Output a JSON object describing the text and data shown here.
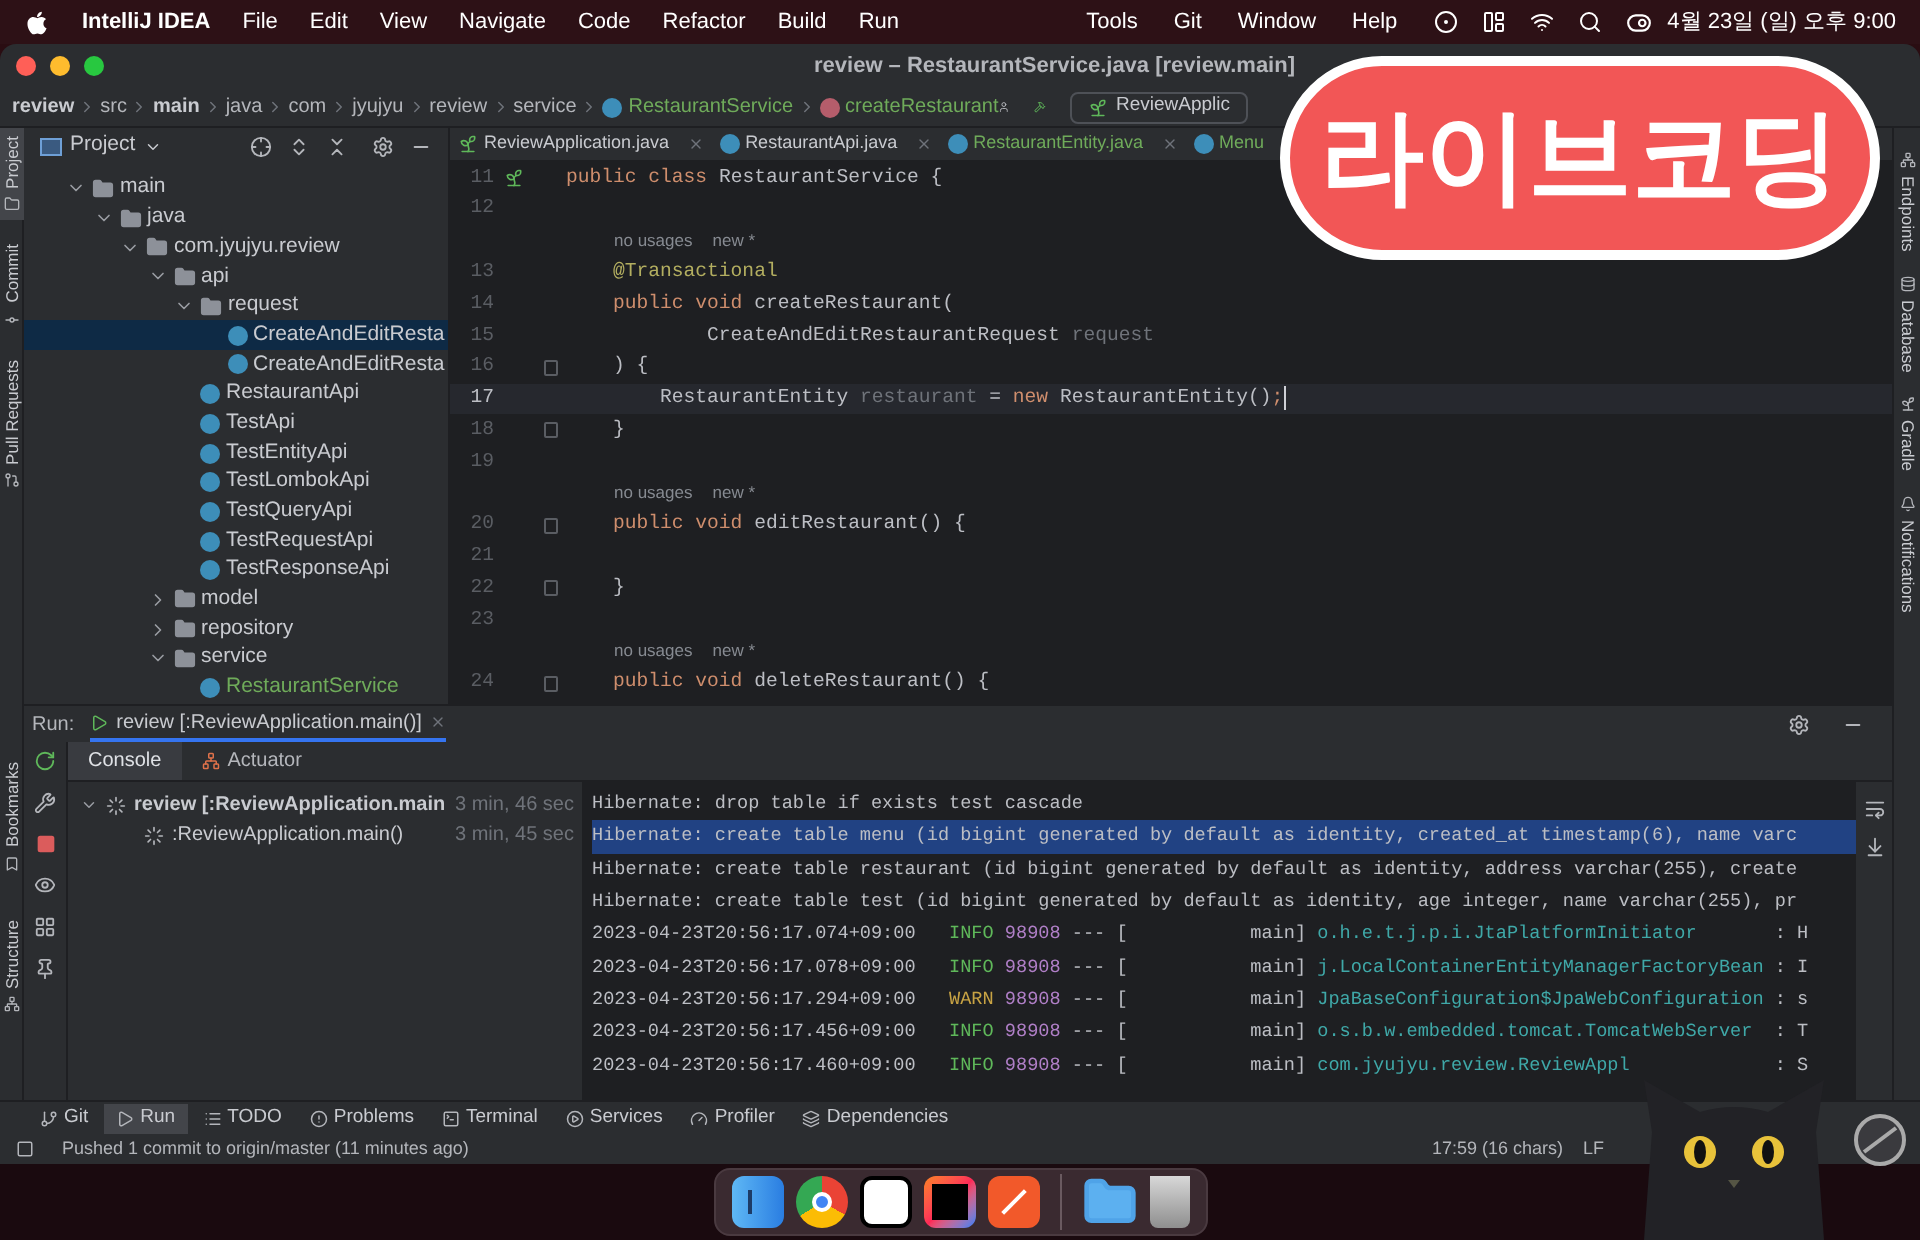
{
  "menu_bar": {
    "app_name": "IntelliJ IDEA",
    "left_items": [
      "File",
      "Edit",
      "View",
      "Navigate",
      "Code",
      "Refactor",
      "Build",
      "Run"
    ],
    "right_items": [
      "Tools",
      "Git",
      "Window",
      "Help"
    ],
    "clock": "4월 23일 (일) 오후 9:00"
  },
  "window": {
    "title": "review – RestaurantService.java [review.main]"
  },
  "breadcrumb": [
    {
      "label": "review",
      "kind": "folder",
      "emphasized": true
    },
    {
      "label": "src",
      "kind": "folder",
      "emphasized": false
    },
    {
      "label": "main",
      "kind": "folder",
      "emphasized": true
    },
    {
      "label": "java",
      "kind": "folder",
      "emphasized": false
    },
    {
      "label": "com",
      "kind": "folder",
      "emphasized": false
    },
    {
      "label": "jyujyu",
      "kind": "folder",
      "emphasized": false
    },
    {
      "label": "review",
      "kind": "folder",
      "emphasized": false
    },
    {
      "label": "service",
      "kind": "folder",
      "emphasized": false
    },
    {
      "label": "RestaurantService",
      "kind": "class",
      "emphasized": false
    },
    {
      "label": "createRestaurant",
      "kind": "method",
      "emphasized": false
    }
  ],
  "run_config": {
    "label": "ReviewApplic"
  },
  "left_tool_strip": {
    "top": [
      {
        "label": "Project",
        "selected": true
      },
      {
        "label": "Commit",
        "selected": false
      },
      {
        "label": "Pull Requests",
        "selected": false
      }
    ],
    "bottom": [
      {
        "label": "Bookmarks",
        "selected": false
      },
      {
        "label": "Structure",
        "selected": false
      }
    ]
  },
  "right_tool_strip": [
    {
      "label": "Endpoints"
    },
    {
      "label": "Database"
    },
    {
      "label": "Gradle"
    },
    {
      "label": "Notifications"
    }
  ],
  "project_panel": {
    "title": "Project",
    "tree": [
      {
        "label": "main",
        "kind": "folder",
        "expanded": true,
        "selected": false,
        "added": false,
        "children": [
          {
            "label": "java",
            "kind": "folder",
            "expanded": true,
            "selected": false,
            "added": false,
            "children": [
              {
                "label": "com.jyujyu.review",
                "kind": "folder",
                "expanded": true,
                "selected": false,
                "added": false,
                "children": [
                  {
                    "label": "api",
                    "kind": "folder",
                    "expanded": true,
                    "selected": false,
                    "added": false,
                    "children": [
                      {
                        "label": "request",
                        "kind": "folder",
                        "expanded": true,
                        "selected": false,
                        "added": false,
                        "children": [
                          {
                            "label": "CreateAndEditResta",
                            "kind": "class",
                            "selected": true,
                            "added": false
                          },
                          {
                            "label": "CreateAndEditResta",
                            "kind": "class",
                            "selected": false,
                            "added": false
                          }
                        ]
                      },
                      {
                        "label": "RestaurantApi",
                        "kind": "class",
                        "selected": false,
                        "added": false
                      },
                      {
                        "label": "TestApi",
                        "kind": "class",
                        "selected": false,
                        "added": false
                      },
                      {
                        "label": "TestEntityApi",
                        "kind": "class",
                        "selected": false,
                        "added": false
                      },
                      {
                        "label": "TestLombokApi",
                        "kind": "class",
                        "selected": false,
                        "added": false
                      },
                      {
                        "label": "TestQueryApi",
                        "kind": "class",
                        "selected": false,
                        "added": false
                      },
                      {
                        "label": "TestRequestApi",
                        "kind": "class",
                        "selected": false,
                        "added": false
                      },
                      {
                        "label": "TestResponseApi",
                        "kind": "class",
                        "selected": false,
                        "added": false
                      }
                    ]
                  },
                  {
                    "label": "model",
                    "kind": "folder",
                    "expanded": false,
                    "selected": false,
                    "added": false
                  },
                  {
                    "label": "repository",
                    "kind": "folder",
                    "expanded": false,
                    "selected": false,
                    "added": false
                  },
                  {
                    "label": "service",
                    "kind": "folder",
                    "expanded": true,
                    "selected": false,
                    "added": false,
                    "children": [
                      {
                        "label": "RestaurantService",
                        "kind": "class",
                        "selected": false,
                        "added": true
                      }
                    ]
                  }
                ]
              }
            ]
          }
        ]
      }
    ]
  },
  "editor_tabs": [
    {
      "label": "ReviewApplication.java",
      "kind": "app",
      "added": false
    },
    {
      "label": "RestaurantApi.java",
      "kind": "class",
      "added": false
    },
    {
      "label": "RestaurantEntity.java",
      "kind": "class",
      "added": true
    },
    {
      "label": "Menu",
      "kind": "class",
      "added": true
    }
  ],
  "editor": {
    "lines": [
      {
        "kind": "code",
        "number": "11",
        "marker": true,
        "fold": false,
        "current": false,
        "tokens": [
          {
            "text": "public class ",
            "kind": "keyword"
          },
          {
            "text": "RestaurantService {",
            "kind": "plain"
          }
        ]
      },
      {
        "kind": "code",
        "number": "12",
        "marker": false,
        "fold": false,
        "current": false
      },
      {
        "kind": "hint",
        "texts": [
          "no usages",
          "new *"
        ]
      },
      {
        "kind": "code",
        "number": "13",
        "marker": false,
        "fold": false,
        "current": false,
        "tokens": [
          {
            "text": "    @Transactional",
            "kind": "annotation"
          }
        ]
      },
      {
        "kind": "code",
        "number": "14",
        "marker": false,
        "fold": false,
        "current": false,
        "tokens": [
          {
            "text": "    public void ",
            "kind": "keyword"
          },
          {
            "text": "createRestaurant(",
            "kind": "plain"
          }
        ]
      },
      {
        "kind": "code",
        "number": "15",
        "marker": false,
        "fold": false,
        "current": false,
        "tokens": [
          {
            "text": "            CreateAndEditRestaurantRequest ",
            "kind": "plain"
          },
          {
            "text": "request",
            "kind": "unused"
          }
        ]
      },
      {
        "kind": "code",
        "number": "16",
        "marker": false,
        "fold": true,
        "current": false,
        "tokens": [
          {
            "text": "    ) {",
            "kind": "plain"
          }
        ]
      },
      {
        "kind": "code",
        "number": "17",
        "marker": false,
        "fold": false,
        "current": true,
        "tokens": [
          {
            "text": "        RestaurantEntity ",
            "kind": "plain"
          },
          {
            "text": "restaurant",
            "kind": "unused"
          },
          {
            "text": " = ",
            "kind": "plain"
          },
          {
            "text": "new ",
            "kind": "keyword"
          },
          {
            "text": "RestaurantEntity()",
            "kind": "plain"
          },
          {
            "text": ";",
            "kind": "keyword"
          }
        ]
      },
      {
        "kind": "code",
        "number": "18",
        "marker": false,
        "fold": true,
        "current": false,
        "tokens": [
          {
            "text": "    }",
            "kind": "plain"
          }
        ]
      },
      {
        "kind": "code",
        "number": "19",
        "marker": false,
        "fold": false,
        "current": false
      },
      {
        "kind": "hint",
        "texts": [
          "no usages",
          "new *"
        ]
      },
      {
        "kind": "code",
        "number": "20",
        "marker": false,
        "fold": true,
        "current": false,
        "tokens": [
          {
            "text": "    public void ",
            "kind": "keyword"
          },
          {
            "text": "editRestaurant() {",
            "kind": "plain"
          }
        ]
      },
      {
        "kind": "code",
        "number": "21",
        "marker": false,
        "fold": false,
        "current": false
      },
      {
        "kind": "code",
        "number": "22",
        "marker": false,
        "fold": true,
        "current": false,
        "tokens": [
          {
            "text": "    }",
            "kind": "plain"
          }
        ]
      },
      {
        "kind": "code",
        "number": "23",
        "marker": false,
        "fold": false,
        "current": false
      },
      {
        "kind": "hint",
        "texts": [
          "no usages",
          "new *"
        ]
      },
      {
        "kind": "code",
        "number": "24",
        "marker": false,
        "fold": true,
        "current": false,
        "tokens": [
          {
            "text": "    public void ",
            "kind": "keyword"
          },
          {
            "text": "deleteRestaurant() {",
            "kind": "plain"
          }
        ]
      }
    ]
  },
  "run_panel": {
    "label": "Run:",
    "tab": "review [:ReviewApplication.main()]",
    "subtabs": [
      {
        "label": "Console",
        "selected": true
      },
      {
        "label": "Actuator",
        "selected": false
      }
    ],
    "tree": [
      {
        "label": "review [:ReviewApplication.main",
        "time": "3 min, 46 sec",
        "expanded": true,
        "children": [
          {
            "label": ":ReviewApplication.main()",
            "time": "3 min, 45 sec"
          }
        ]
      }
    ],
    "console": [
      {
        "kind": "text",
        "text": "Hibernate: drop table if exists test cascade",
        "selected": false
      },
      {
        "kind": "text",
        "text": "Hibernate: create table menu (id bigint generated by default as identity, created_at timestamp(6), name varc",
        "selected": true
      },
      {
        "kind": "text",
        "text": "Hibernate: create table restaurant (id bigint generated by default as identity, address varchar(255), create",
        "selected": false
      },
      {
        "kind": "text",
        "text": "Hibernate: create table test (id bigint generated by default as identity, age integer, name varchar(255), pr",
        "selected": false
      },
      {
        "kind": "info_log",
        "time": "2023-04-23T20:56:17.074+09:00",
        "severity_text": "INFO",
        "pid": "98908",
        "sep": "---",
        "thread": "[           main]",
        "logger": "o.h.e.t.j.p.i.JtaPlatformInitiator",
        "tail": ": H",
        "selected": false
      },
      {
        "kind": "info_log",
        "time": "2023-04-23T20:56:17.078+09:00",
        "severity_text": "INFO",
        "pid": "98908",
        "sep": "---",
        "thread": "[           main]",
        "logger": "j.LocalContainerEntityManagerFactoryBean",
        "tail": ": I",
        "selected": false
      },
      {
        "kind": "warn_log",
        "time": "2023-04-23T20:56:17.294+09:00",
        "severity_text": "WARN",
        "pid": "98908",
        "sep": "---",
        "thread": "[           main]",
        "logger": "JpaBaseConfiguration$JpaWebConfiguration",
        "tail": ": s",
        "selected": false
      },
      {
        "kind": "info_log",
        "time": "2023-04-23T20:56:17.456+09:00",
        "severity_text": "INFO",
        "pid": "98908",
        "sep": "---",
        "thread": "[           main]",
        "logger": "o.s.b.w.embedded.tomcat.TomcatWebServer",
        "tail": ": T",
        "selected": false
      },
      {
        "kind": "info_log",
        "time": "2023-04-23T20:56:17.460+09:00",
        "severity_text": "INFO",
        "pid": "98908",
        "sep": "---",
        "thread": "[           main]",
        "logger": "com.jyujyu.review.ReviewAppl",
        "tail": ": S",
        "selected": false
      }
    ]
  },
  "tool_tabs": [
    {
      "label": "Git",
      "kind": "git",
      "selected": false
    },
    {
      "label": "Run",
      "kind": "run",
      "selected": true
    },
    {
      "label": "TODO",
      "kind": "todo",
      "selected": false
    },
    {
      "label": "Problems",
      "kind": "problems",
      "selected": false
    },
    {
      "label": "Terminal",
      "kind": "terminal",
      "selected": false
    },
    {
      "label": "Services",
      "kind": "services",
      "selected": false
    },
    {
      "label": "Profiler",
      "kind": "profiler",
      "selected": false
    },
    {
      "label": "Dependencies",
      "kind": "dependencies",
      "selected": false
    }
  ],
  "status_bar": {
    "message": "Pushed 1 commit to origin/master (11 minutes ago)",
    "position": "17:59 (16 chars)",
    "line_ending": "LF"
  },
  "dock": [
    {
      "kind": "finder"
    },
    {
      "kind": "chrome"
    },
    {
      "kind": "notion"
    },
    {
      "kind": "intellij"
    },
    {
      "kind": "pen"
    },
    {
      "kind": "separator"
    },
    {
      "kind": "folder"
    },
    {
      "kind": "trash"
    }
  ],
  "overlay_badge": {
    "text": "라이브코딩"
  }
}
